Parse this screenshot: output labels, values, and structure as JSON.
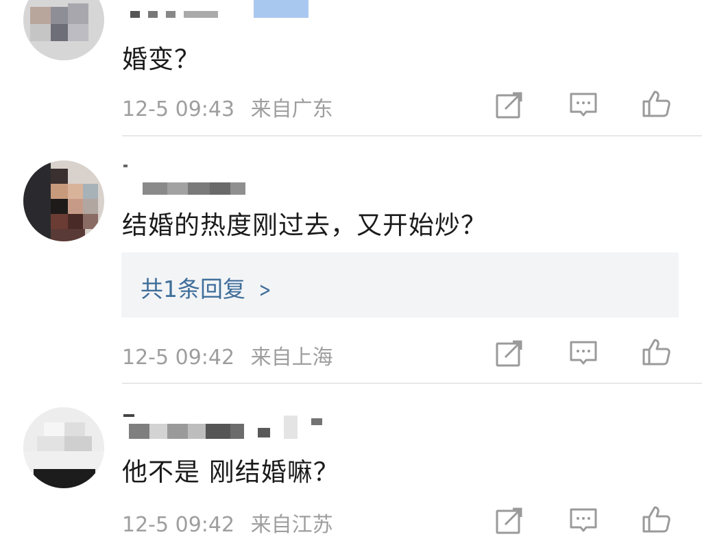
{
  "comments": [
    {
      "content": "婚变？",
      "timestamp": "12-5 09:43",
      "location": "来自广东"
    },
    {
      "content": "结婚的热度刚过去，又开始炒？",
      "replies_label": "共1条回复",
      "timestamp": "12-5 09:42",
      "location": "来自上海"
    },
    {
      "content": "他不是 刚结婚嘛？",
      "timestamp": "12-5 09:42",
      "location": "来自江苏"
    }
  ],
  "icons": {
    "share": "share-icon",
    "comment": "comment-icon",
    "like": "like-icon"
  },
  "colors": {
    "text": "#1b1b1b",
    "meta": "#9e9e9e",
    "link": "#3f6e9a",
    "icon": "#9a9a9a"
  }
}
